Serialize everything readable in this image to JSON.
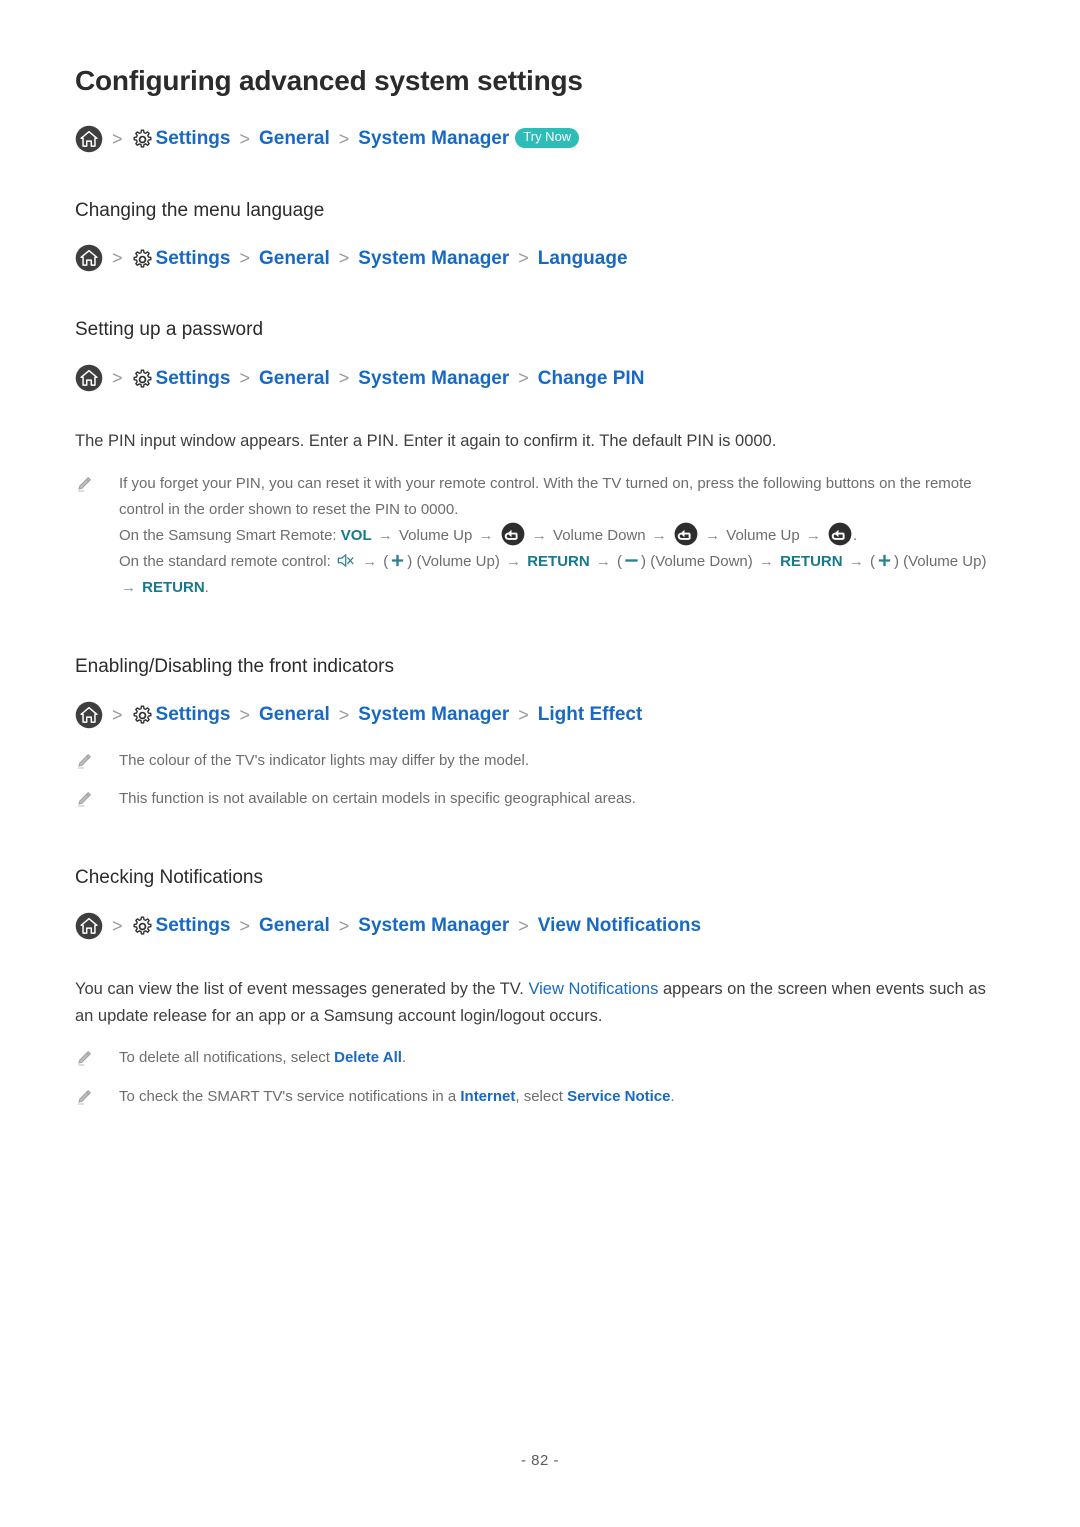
{
  "page": {
    "title": "Configuring advanced system settings",
    "page_number": "- 82 -"
  },
  "colors": {
    "link_blue": "#1869c4",
    "teal_badge": "#2bbdb6",
    "teal_bold": "#17788e",
    "body_text": "#3e3e3e",
    "note_text": "#6d6d6d",
    "icon_dark": "#3c3c3c"
  },
  "breadcrumbs": {
    "top": {
      "home": "home-icon",
      "gear": "gear-icon",
      "items": [
        "Settings",
        "General",
        "System Manager"
      ],
      "badge": "Try Now",
      "separator": ">"
    },
    "language": {
      "items": [
        "Settings",
        "General",
        "System Manager",
        "Language"
      ],
      "separator": ">"
    },
    "change_pin": {
      "items": [
        "Settings",
        "General",
        "System Manager",
        "Change PIN"
      ],
      "separator": ">"
    },
    "light_effect": {
      "items": [
        "Settings",
        "General",
        "System Manager",
        "Light Effect"
      ],
      "separator": ">"
    },
    "view_notifications": {
      "items": [
        "Settings",
        "General",
        "System Manager",
        "View Notifications"
      ],
      "separator": ">"
    }
  },
  "sections": {
    "menu_language": {
      "heading": "Changing the menu language"
    },
    "password": {
      "heading": "Setting up a password",
      "body": "The PIN input window appears. Enter a PIN. Enter it again to confirm it. The default PIN is 0000.",
      "note": {
        "line1": "If you forget your PIN, you can reset it with your remote control. With the TV turned on, press the following buttons on the remote control in the order shown to reset the PIN to 0000.",
        "smart_remote_prefix": "On the Samsung Smart Remote:",
        "vol_label": "VOL",
        "volume_up": "Volume Up",
        "volume_down": "Volume Down",
        "standard_remote_prefix": "On the standard remote control:",
        "volume_up_paren": "(Volume Up)",
        "volume_down_paren": "(Volume Down)",
        "return_label": "RETURN",
        "period": "."
      }
    },
    "front_indicators": {
      "heading": "Enabling/Disabling the front indicators",
      "notes": [
        "The colour of the TV's indicator lights may differ by the model.",
        "This function is not available on certain models in specific geographical areas."
      ]
    },
    "notifications": {
      "heading": "Checking Notifications",
      "body_part1": "You can view the list of event messages generated by the TV. ",
      "body_link": "View Notifications",
      "body_part2": " appears on the screen when events such as an update release for an app or a Samsung account login/logout occurs.",
      "notes": [
        {
          "prefix": "To delete all notifications, select ",
          "link": "Delete All",
          "suffix": "."
        },
        {
          "prefix": "To check the SMART TV's service notifications in a ",
          "link": "Internet",
          "middle": ", select ",
          "link2": "Service Notice",
          "suffix": "."
        }
      ]
    }
  },
  "icons": {
    "home": "home-icon",
    "gear": "gear-icon",
    "pencil": "pencil-icon",
    "return": "return-icon",
    "mute": "mute-icon",
    "plus": "plus-icon",
    "minus": "minus-icon",
    "arrow": "→"
  }
}
